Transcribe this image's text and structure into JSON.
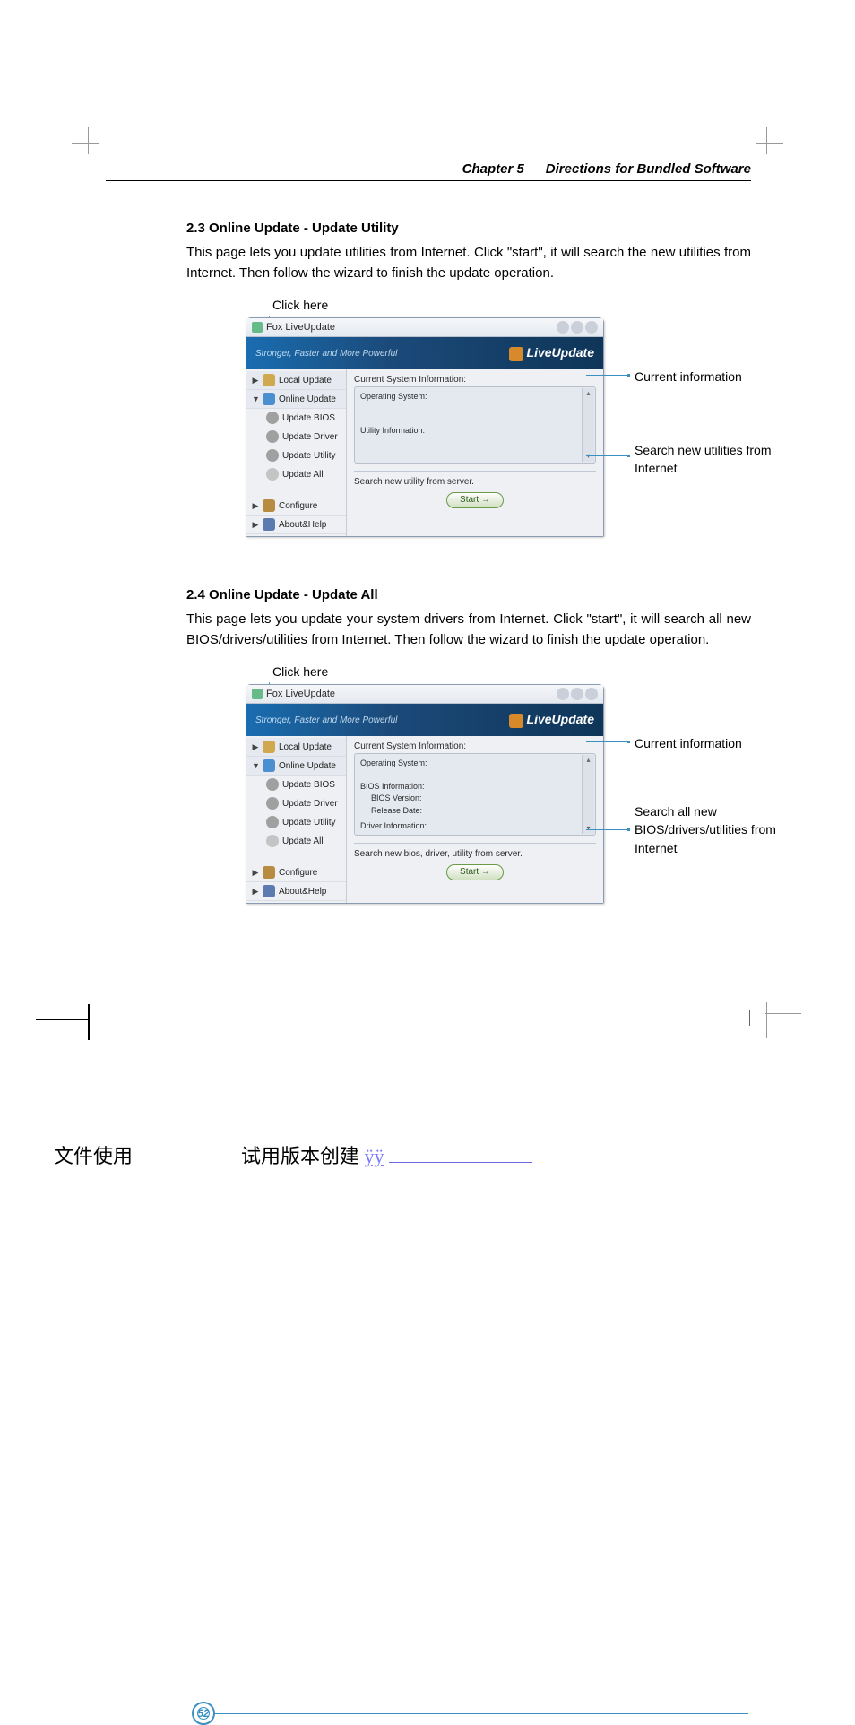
{
  "header": {
    "chapter": "Chapter 5",
    "title": "Directions for Bundled Software"
  },
  "section1": {
    "title": "2.3 Online Update - Update Utility",
    "body": "This page lets you update utilities from Internet. Click \"start\", it will search the new utilities from Internet. Then follow the wizard to finish the update operation.",
    "click_here": "Click here",
    "callout_info": "Current information",
    "callout_search": "Search new utilities from Internet"
  },
  "section2": {
    "title": "2.4 Online Update - Update All",
    "body": "This page lets you update your system drivers from Internet. Click \"start\", it will search all new BIOS/drivers/utilities from Internet. Then follow the wizard to finish the update operation.",
    "click_here": "Click here",
    "callout_info": "Current information",
    "callout_search": "Search all new BIOS/drivers/utilities from Internet"
  },
  "app": {
    "title": "Fox LiveUpdate",
    "slogan": "Stronger, Faster and More Powerful",
    "brand": "LiveUpdate",
    "nav": {
      "local_update": "Local Update",
      "online_update": "Online Update",
      "update_bios": "Update BIOS",
      "update_driver": "Update Driver",
      "update_utility": "Update Utility",
      "update_all": "Update All",
      "configure": "Configure",
      "about_help": "About&Help"
    },
    "content1": {
      "cur_sys_label": "Current System Information:",
      "os_label": "Operating System:",
      "util_label": "Utility Information:",
      "search_label": "Search new utility from server.",
      "start": "Start"
    },
    "content2": {
      "cur_sys_label": "Current System Information:",
      "os_label": "Operating System:",
      "bios_info": "BIOS Information:",
      "bios_ver": "BIOS Version:",
      "rel_date": "Release Date:",
      "drv_info": "Driver Information:",
      "search_label": "Search new bios, driver, utility from server.",
      "start": "Start"
    }
  },
  "page_number": "52",
  "footer": {
    "left": "文件使用",
    "mid": "试用版本创建",
    "link": "ÿÿ"
  }
}
